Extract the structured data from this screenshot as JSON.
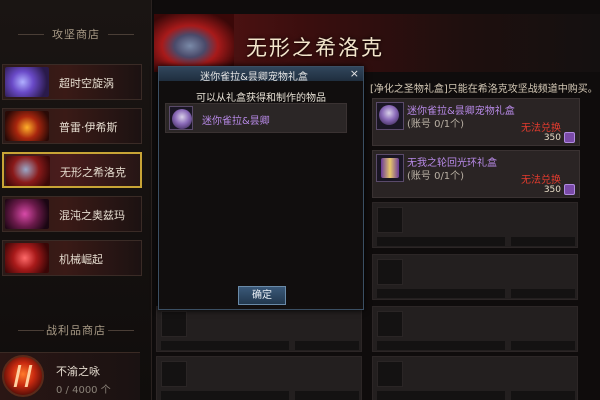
{
  "sidebar": {
    "raid_shop_title": "攻坚商店",
    "dungeons": [
      {
        "label": "超时空旋涡",
        "active": false
      },
      {
        "label": "普雷·伊希斯",
        "active": false
      },
      {
        "label": "无形之希洛克",
        "active": true
      },
      {
        "label": "混沌之奥兹玛",
        "active": false
      },
      {
        "label": "机械崛起",
        "active": false
      }
    ],
    "loot_shop_title": "战利品商店",
    "reward": {
      "name": "不渝之咏",
      "count": "0 / 4000 个"
    }
  },
  "main": {
    "boss_title": "无形之希洛克",
    "notice": "[净化之圣物礼盒]只能在希洛克攻坚战频道中购买。",
    "items": [
      {
        "name": "迷你雀拉&昙卿宠物礼盒",
        "limit": "(账号 0/1个)",
        "status": "无法兑换",
        "price": "350"
      },
      {
        "name": "无我之轮回光环礼盒",
        "limit": "(账号 0/1个)",
        "status": "无法兑换",
        "price": "350"
      }
    ]
  },
  "modal": {
    "title": "迷你雀拉&昙卿宠物礼盒",
    "subtitle": "可以从礼盒获得和制作的物品",
    "rows": [
      {
        "name": "迷你雀拉&昙卿"
      }
    ],
    "close_icon": "×",
    "confirm_label": "确定"
  }
}
